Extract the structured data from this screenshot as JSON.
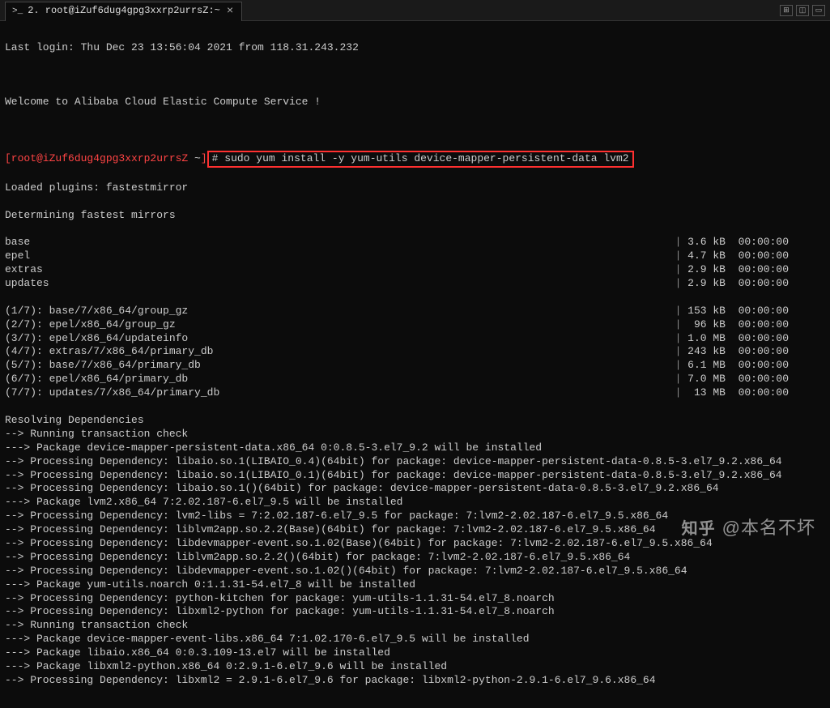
{
  "tab": {
    "icon": ">_",
    "title": "2. root@iZuf6dug4gpg3xxrp2urrsZ:~",
    "close": "×"
  },
  "window_controls": {
    "a": "⊞",
    "b": "◫",
    "c": "▭"
  },
  "last_login": "Last login: Thu Dec 23 13:56:04 2021 from 118.31.243.232",
  "welcome": "Welcome to Alibaba Cloud Elastic Compute Service !",
  "prompt_user": "[root@iZuf6dug4gpg3xxrp2urrsZ ",
  "prompt_path": "~",
  "prompt_end": "]",
  "command": "# sudo yum install -y yum-utils device-mapper-persistent-data lvm2",
  "loaded": "Loaded plugins: fastestmirror",
  "determining": "Determining fastest mirrors",
  "repos": [
    {
      "name": "base",
      "size": "3.6 kB",
      "time": "00:00:00"
    },
    {
      "name": "epel",
      "size": "4.7 kB",
      "time": "00:00:00"
    },
    {
      "name": "extras",
      "size": "2.9 kB",
      "time": "00:00:00"
    },
    {
      "name": "updates",
      "size": "2.9 kB",
      "time": "00:00:00"
    }
  ],
  "downloads": [
    {
      "name": "(1/7): base/7/x86_64/group_gz",
      "size": "153 kB",
      "time": "00:00:00"
    },
    {
      "name": "(2/7): epel/x86_64/group_gz",
      "size": " 96 kB",
      "time": "00:00:00"
    },
    {
      "name": "(3/7): epel/x86_64/updateinfo",
      "size": "1.0 MB",
      "time": "00:00:00"
    },
    {
      "name": "(4/7): extras/7/x86_64/primary_db",
      "size": "243 kB",
      "time": "00:00:00"
    },
    {
      "name": "(5/7): base/7/x86_64/primary_db",
      "size": "6.1 MB",
      "time": "00:00:00"
    },
    {
      "name": "(6/7): epel/x86_64/primary_db",
      "size": "7.0 MB",
      "time": "00:00:00"
    },
    {
      "name": "(7/7): updates/7/x86_64/primary_db",
      "size": " 13 MB",
      "time": "00:00:00"
    }
  ],
  "deps": [
    "Resolving Dependencies",
    "--> Running transaction check",
    "---> Package device-mapper-persistent-data.x86_64 0:0.8.5-3.el7_9.2 will be installed",
    "--> Processing Dependency: libaio.so.1(LIBAIO_0.4)(64bit) for package: device-mapper-persistent-data-0.8.5-3.el7_9.2.x86_64",
    "--> Processing Dependency: libaio.so.1(LIBAIO_0.1)(64bit) for package: device-mapper-persistent-data-0.8.5-3.el7_9.2.x86_64",
    "--> Processing Dependency: libaio.so.1()(64bit) for package: device-mapper-persistent-data-0.8.5-3.el7_9.2.x86_64",
    "---> Package lvm2.x86_64 7:2.02.187-6.el7_9.5 will be installed",
    "--> Processing Dependency: lvm2-libs = 7:2.02.187-6.el7_9.5 for package: 7:lvm2-2.02.187-6.el7_9.5.x86_64",
    "--> Processing Dependency: liblvm2app.so.2.2(Base)(64bit) for package: 7:lvm2-2.02.187-6.el7_9.5.x86_64",
    "--> Processing Dependency: libdevmapper-event.so.1.02(Base)(64bit) for package: 7:lvm2-2.02.187-6.el7_9.5.x86_64",
    "--> Processing Dependency: liblvm2app.so.2.2()(64bit) for package: 7:lvm2-2.02.187-6.el7_9.5.x86_64",
    "--> Processing Dependency: libdevmapper-event.so.1.02()(64bit) for package: 7:lvm2-2.02.187-6.el7_9.5.x86_64",
    "---> Package yum-utils.noarch 0:1.1.31-54.el7_8 will be installed",
    "--> Processing Dependency: python-kitchen for package: yum-utils-1.1.31-54.el7_8.noarch",
    "--> Processing Dependency: libxml2-python for package: yum-utils-1.1.31-54.el7_8.noarch",
    "--> Running transaction check",
    "---> Package device-mapper-event-libs.x86_64 7:1.02.170-6.el7_9.5 will be installed",
    "---> Package libaio.x86_64 0:0.3.109-13.el7 will be installed",
    "---> Package libxml2-python.x86_64 0:2.9.1-6.el7_9.6 will be installed",
    "--> Processing Dependency: libxml2 = 2.9.1-6.el7_9.6 for package: libxml2-python-2.9.1-6.el7_9.6.x86_64"
  ],
  "watermark": {
    "logo": "知乎",
    "text": "@本名不坏"
  }
}
